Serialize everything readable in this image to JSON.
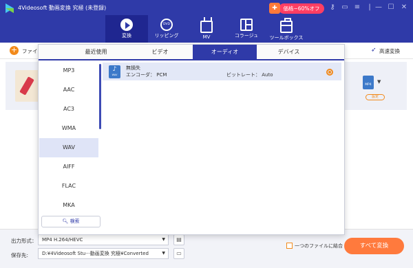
{
  "app": {
    "title": "4Videosoft 動画変換 究極 (未登録)"
  },
  "promo": {
    "label": "価格−60%オフ"
  },
  "nav": {
    "tabs": [
      {
        "label": "変換",
        "active": true
      },
      {
        "label": "リッピング",
        "active": false
      },
      {
        "label": "MV",
        "active": false
      },
      {
        "label": "コラージュ",
        "active": false
      },
      {
        "label": "ツールボックス",
        "active": false
      }
    ]
  },
  "toolbar": {
    "add_file_label": "ファイル",
    "fast_convert_label": "高速変換"
  },
  "file_row": {
    "format_icon": "MP4",
    "settings_label": "設定"
  },
  "format_panel": {
    "tabs": [
      {
        "label": "最近使用",
        "active": false
      },
      {
        "label": "ビデオ",
        "active": false
      },
      {
        "label": "オーディオ",
        "active": true
      },
      {
        "label": "デバイス",
        "active": false
      }
    ],
    "formats": [
      "MP3",
      "AAC",
      "AC3",
      "WMA",
      "WAV",
      "AIFF",
      "FLAC",
      "MKA"
    ],
    "selected_format": "WAV",
    "search_label": "検索",
    "preset": {
      "name": "無損失",
      "encoder": "エンコーダ： PCM",
      "bitrate": "ビットレート： Auto"
    }
  },
  "bottom": {
    "output_format_label": "出力形式：",
    "output_format_value": "MP4 H.264/HEVC",
    "save_to_label": "保存先:",
    "save_to_value": "D:¥4Videosoft Stu···動画変換 究極¥Converted",
    "merge_label": "一つのファイルに結合",
    "convert_all_label": "すべて変換"
  },
  "colors": {
    "brand": "#2f3aa8",
    "accent": "#ff7a3d",
    "promo": "#ff3e63"
  }
}
